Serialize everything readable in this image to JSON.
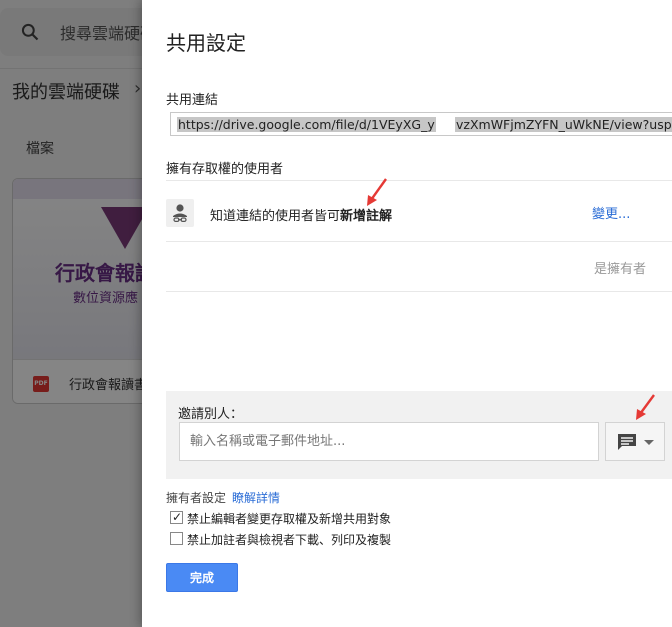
{
  "background": {
    "search_placeholder": "搜尋雲端硬碟",
    "drive_title": "我的雲端硬碟",
    "files_label": "檔案",
    "file_name": "行政會報讀書",
    "thumb_title": "行政會報讀",
    "thumb_subtitle": "數位資源應"
  },
  "dialog": {
    "title": "共用設定",
    "share_link_label": "共用連結",
    "share_link_part1": "https://drive.google.com/file/d/1VEyXG_y",
    "share_link_part2": "vzXmWFjmZYFN_uWkNE/view?usp=",
    "access_label": "擁有存取權的使用者",
    "access_text_prefix": "知道連結的使用者皆可",
    "access_text_strong": "新增註解",
    "change_link": "變更...",
    "owner_text": "是擁有者",
    "invite_label": "邀請別人：",
    "invite_placeholder": "輸入名稱或電子郵件地址...",
    "owner_settings_label": "擁有者設定",
    "learn_more_link": "瞭解詳情",
    "checkbox1_label": "禁止編輯者變更存取權及新增共用對象",
    "checkbox1_checked": true,
    "checkbox2_label": "禁止加註者與檢視者下載、列印及複製",
    "checkbox2_checked": false,
    "done_button": "完成"
  },
  "icons": {
    "search": "search-icon",
    "person": "person-icon",
    "message": "message-icon",
    "dropdown": "caret-down-icon",
    "pdf": "pdf-icon",
    "annotation_arrow": "red-arrow-annotation"
  },
  "colors": {
    "link": "#2a6cd6",
    "primary_button": "#4a8af4",
    "annotation_arrow": "#e53935",
    "overlay": "#7f7f7f"
  }
}
